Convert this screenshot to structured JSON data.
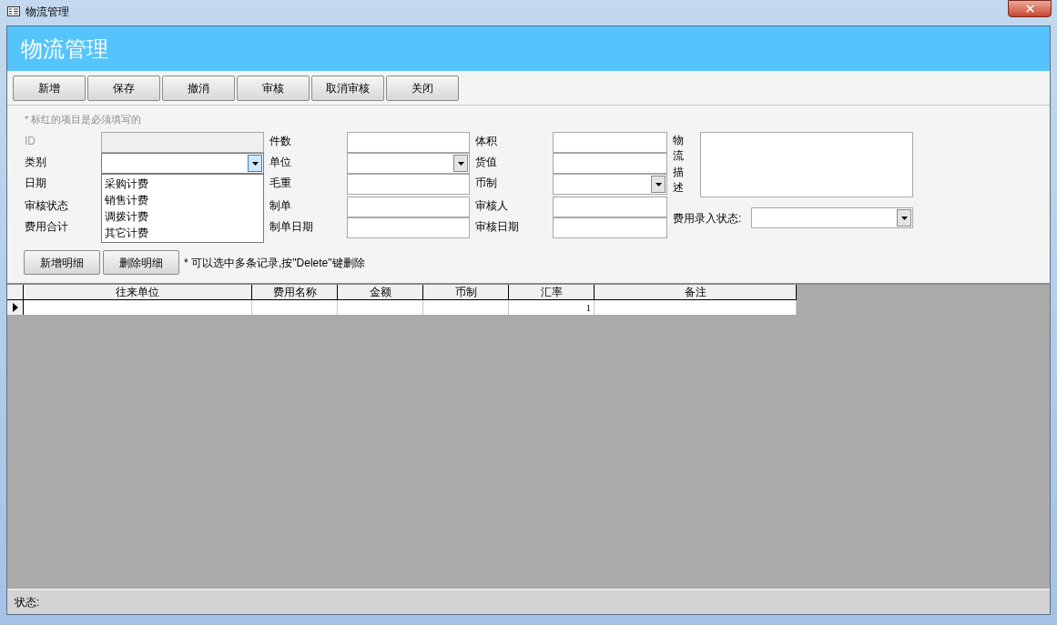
{
  "window": {
    "title": "物流管理"
  },
  "header": {
    "title": "物流管理"
  },
  "toolbar": [
    {
      "label": "新增"
    },
    {
      "label": "保存"
    },
    {
      "label": "撤消"
    },
    {
      "label": "审核"
    },
    {
      "label": "取消审核"
    },
    {
      "label": "关闭"
    }
  ],
  "required_note": "* 标红的项目是必须填写的",
  "field_groups": [
    {
      "fields": [
        {
          "label": "ID",
          "kind": "text",
          "disabled": true
        },
        {
          "label": "类别",
          "kind": "combo",
          "disabled": false,
          "expanded": true,
          "options": [
            "采购计费",
            "销售计费",
            "调拨计费",
            "其它计费"
          ]
        },
        {
          "label": "日期",
          "kind": "covered",
          "disabled": false
        },
        {
          "label": "审核状态",
          "kind": "covered",
          "disabled": false
        },
        {
          "label": "费用合计",
          "kind": "covered",
          "disabled": false
        }
      ]
    },
    {
      "fields": [
        {
          "label": "件数",
          "kind": "text",
          "disabled": false
        },
        {
          "label": "单位",
          "kind": "combo",
          "disabled": false,
          "expanded": false
        },
        {
          "label": "毛重",
          "kind": "text",
          "disabled": false
        },
        {
          "label": "制单",
          "kind": "text",
          "disabled": false
        },
        {
          "label": "制单日期",
          "kind": "text",
          "disabled": false
        }
      ]
    },
    {
      "fields": [
        {
          "label": "体积",
          "kind": "text",
          "disabled": false
        },
        {
          "label": "货值",
          "kind": "text",
          "disabled": false
        },
        {
          "label": "币制",
          "kind": "combo",
          "disabled": false,
          "expanded": false
        },
        {
          "label": "审核人",
          "kind": "text",
          "disabled": false
        },
        {
          "label": "审核日期",
          "kind": "text",
          "disabled": false
        }
      ]
    }
  ],
  "description": {
    "label": "物流描述"
  },
  "fee_status": {
    "label": "费用录入状态:"
  },
  "detail_buttons": [
    {
      "label": "新增明细"
    },
    {
      "label": "删除明细"
    }
  ],
  "detail_note": "* 可以选中多条记录,按\"Delete\"键删除",
  "table": {
    "columns": [
      "往来单位",
      "费用名称",
      "金额",
      "币制",
      "汇率",
      "备注"
    ],
    "rows": [
      {
        "current": true,
        "cells": [
          null,
          null,
          null,
          null,
          "1",
          null
        ]
      }
    ]
  },
  "status_bar": {
    "label": "状态:"
  }
}
